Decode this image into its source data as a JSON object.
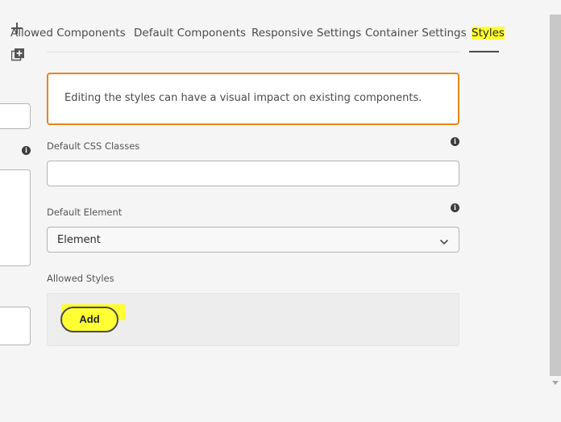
{
  "tabs": [
    {
      "label": "Allowed Components",
      "active": false
    },
    {
      "label": "Default Components",
      "active": false
    },
    {
      "label": "Responsive Settings",
      "active": false
    },
    {
      "label": "Container Settings",
      "active": false
    },
    {
      "label": "Styles",
      "active": true
    }
  ],
  "alert": {
    "message": "Editing the styles can have a visual impact on existing components."
  },
  "fields": {
    "default_css_classes": {
      "label": "Default CSS Classes",
      "value": ""
    },
    "default_element": {
      "label": "Default Element",
      "value": "Element"
    },
    "allowed_styles": {
      "label": "Allowed Styles",
      "add_label": "Add"
    }
  },
  "icons": {
    "add": "plus-icon",
    "copy_add": "copy-add-icon",
    "info": "info-icon",
    "chevron": "chevron-down-icon"
  },
  "colors": {
    "alert_border": "#e68619",
    "highlight": "#ffff33"
  }
}
